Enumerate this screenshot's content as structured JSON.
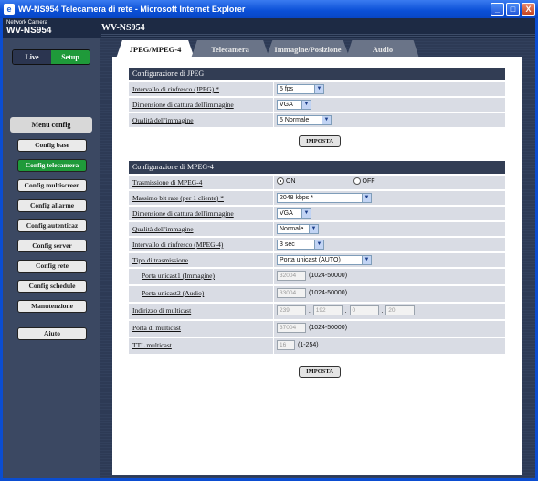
{
  "window": {
    "title": "WV-NS954 Telecamera di rete - Microsoft Internet Explorer",
    "buttons": [
      "_",
      "□",
      "X"
    ]
  },
  "header": {
    "brand_small": "Network Camera",
    "brand_big": "WV-NS954",
    "model": "WV-NS954"
  },
  "modes": {
    "live": "Live",
    "setup": "Setup"
  },
  "menu": {
    "title": "Menu config",
    "items": [
      "Config base",
      "Config telecamera",
      "Config multiscreen",
      "Config allarme",
      "Config autenticaz",
      "Config server",
      "Config rete",
      "Config schedule",
      "Manutenzione",
      "Aiuto"
    ],
    "active_index": 1
  },
  "tabs": [
    "JPEG/MPEG-4",
    "Telecamera",
    "Immagine/Posizione",
    "Audio"
  ],
  "jpeg": {
    "header": "Configurazione di JPEG",
    "refresh_label": "Intervallo di rinfresco (JPEG) *",
    "refresh_value": "5 fps",
    "capture_label": "Dimensione di cattura dell'immagine",
    "capture_value": "VGA",
    "quality_label": "Qualità dell'immagine",
    "quality_value": "5 Normale",
    "submit": "IMPOSTA"
  },
  "mpeg": {
    "header": "Configurazione di MPEG-4",
    "transmission_label": "Trasmissione di MPEG-4",
    "on_label": "ON",
    "off_label": "OFF",
    "bitrate_label": "Massimo bit rate (per 1 cliente) *",
    "bitrate_value": "2048 kbps *",
    "capture_label": "Dimensione di cattura dell'immagine",
    "capture_value": "VGA",
    "quality_label": "Qualità dell'immagine",
    "quality_value": "Normale",
    "refresh_label": "Intervallo di rinfresco (MPEG-4)",
    "refresh_value": "3 sec",
    "type_label": "Tipo di trasmissione",
    "type_value": "Porta unicast (AUTO)",
    "port1_label": "Porta unicast1 (Immagine)",
    "port1_value": "32004",
    "port1_range": "(1024-50000)",
    "port2_label": "Porta unicast2 (Audio)",
    "port2_value": "33004",
    "port2_range": "(1024-50000)",
    "mc_addr_label": "Indirizzo di multicast",
    "mc_addr": [
      "239",
      "192",
      "0",
      "20"
    ],
    "mc_port_label": "Porta di multicast",
    "mc_port_value": "37004",
    "mc_port_range": "(1024-50000)",
    "ttl_label": "TTL multicast",
    "ttl_value": "16",
    "ttl_range": "(1-254)",
    "submit": "IMPOSTA"
  }
}
